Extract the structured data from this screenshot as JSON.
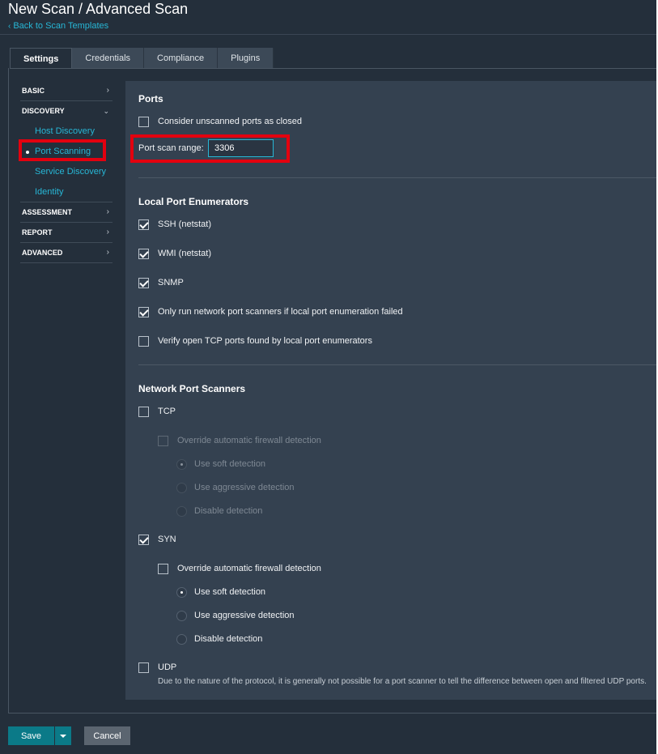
{
  "page": {
    "title": "New Scan / Advanced Scan",
    "back_link": "Back to Scan Templates"
  },
  "tabs": [
    {
      "label": "Settings",
      "active": true
    },
    {
      "label": "Credentials",
      "active": false
    },
    {
      "label": "Compliance",
      "active": false
    },
    {
      "label": "Plugins",
      "active": false
    }
  ],
  "sidebar": {
    "basic": "BASIC",
    "discovery": "DISCOVERY",
    "discovery_items": [
      "Host Discovery",
      "Port Scanning",
      "Service Discovery",
      "Identity"
    ],
    "assessment": "ASSESSMENT",
    "report": "REPORT",
    "advanced": "ADVANCED",
    "active_item": "Port Scanning"
  },
  "ports": {
    "title": "Ports",
    "unscanned_closed_label": "Consider unscanned ports as closed",
    "unscanned_closed_checked": false,
    "range_label": "Port scan range:",
    "range_value": "3306"
  },
  "local_enumerators": {
    "title": "Local Port Enumerators",
    "ssh": {
      "label": "SSH (netstat)",
      "checked": true
    },
    "wmi": {
      "label": "WMI (netstat)",
      "checked": true
    },
    "snmp": {
      "label": "SNMP",
      "checked": true
    },
    "only_if_failed": {
      "label": "Only run network port scanners if local port enumeration failed",
      "checked": true
    },
    "verify_tcp": {
      "label": "Verify open TCP ports found by local port enumerators",
      "checked": false
    }
  },
  "network_scanners": {
    "title": "Network Port Scanners",
    "tcp": {
      "label": "TCP",
      "checked": false,
      "override_label": "Override automatic firewall detection",
      "soft": "Use soft detection",
      "aggressive": "Use aggressive detection",
      "disable": "Disable detection"
    },
    "syn": {
      "label": "SYN",
      "checked": true,
      "override_label": "Override automatic firewall detection",
      "soft": "Use soft detection",
      "aggressive": "Use aggressive detection",
      "disable": "Disable detection"
    },
    "udp": {
      "label": "UDP",
      "checked": false,
      "note": "Due to the nature of the protocol, it is generally not possible for a port scanner to tell the difference between open and filtered UDP ports."
    }
  },
  "actions": {
    "save": "Save",
    "cancel": "Cancel"
  },
  "colors": {
    "accent": "#27b7d6",
    "highlight": "#e3000f",
    "save_button": "#0b7a88"
  }
}
